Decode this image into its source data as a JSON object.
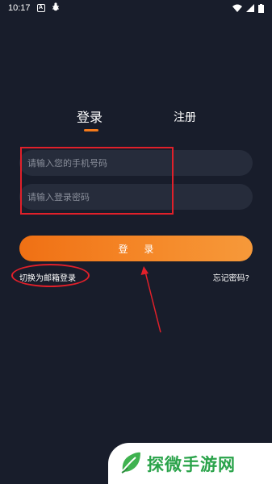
{
  "status_bar": {
    "time": "10:17",
    "icons": [
      "a-notification-icon",
      "bug-icon",
      "wifi-icon",
      "signal-icon",
      "battery-icon"
    ]
  },
  "tabs": [
    {
      "label": "登录",
      "active": true
    },
    {
      "label": "注册",
      "active": false
    }
  ],
  "form": {
    "phone_placeholder": "请输入您的手机号码",
    "password_placeholder": "请输入登录密码",
    "login_label": "登 录",
    "switch_email_label": "切换为邮箱登录",
    "forgot_password_label": "忘记密码?"
  },
  "annotations": {
    "color": "#e0202a"
  },
  "watermark": {
    "text": "探微手游网"
  },
  "colors": {
    "background": "#181d2b",
    "accent": "#f47a1b",
    "input_bg": "#262c3b",
    "watermark_green": "#2aa34a"
  }
}
